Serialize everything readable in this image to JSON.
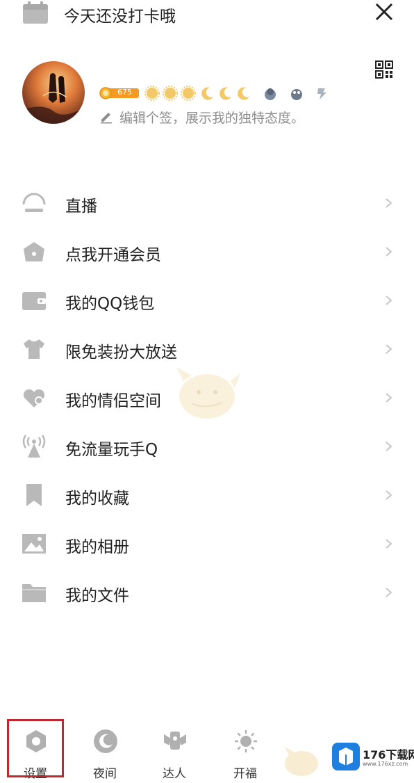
{
  "header": {
    "checkin_text": "今天还没打卡哦",
    "close_icon": "close-icon",
    "qr_icon": "qr-code-icon"
  },
  "profile": {
    "level": "675",
    "signature": "编辑个签，展示我的独特态度。"
  },
  "menu": {
    "items": [
      {
        "label": "直播",
        "icon": "live-icon"
      },
      {
        "label": "点我开通会员",
        "icon": "vip-basket-icon"
      },
      {
        "label": "我的QQ钱包",
        "icon": "wallet-icon"
      },
      {
        "label": "限免装扮大放送",
        "icon": "tshirt-icon"
      },
      {
        "label": "我的情侣空间",
        "icon": "couple-heart-icon"
      },
      {
        "label": "免流量玩手Q",
        "icon": "signal-tower-icon"
      },
      {
        "label": "我的收藏",
        "icon": "bookmark-icon"
      },
      {
        "label": "我的相册",
        "icon": "photo-icon"
      },
      {
        "label": "我的文件",
        "icon": "folder-icon"
      }
    ]
  },
  "bottom_bar": {
    "items": [
      {
        "label": "设置",
        "icon": "settings-icon"
      },
      {
        "label": "夜间",
        "icon": "night-mode-icon"
      },
      {
        "label": "达人",
        "icon": "expert-icon"
      },
      {
        "label": "开福",
        "icon": "sun-icon"
      }
    ]
  },
  "watermark": {
    "text": "176下载网",
    "sub": "www.176xz.com"
  },
  "colors": {
    "icon_gray": "#b9b9b9",
    "text": "#1f1f1f",
    "highlight": "#c1272d",
    "level_orange": "#f59a23"
  }
}
